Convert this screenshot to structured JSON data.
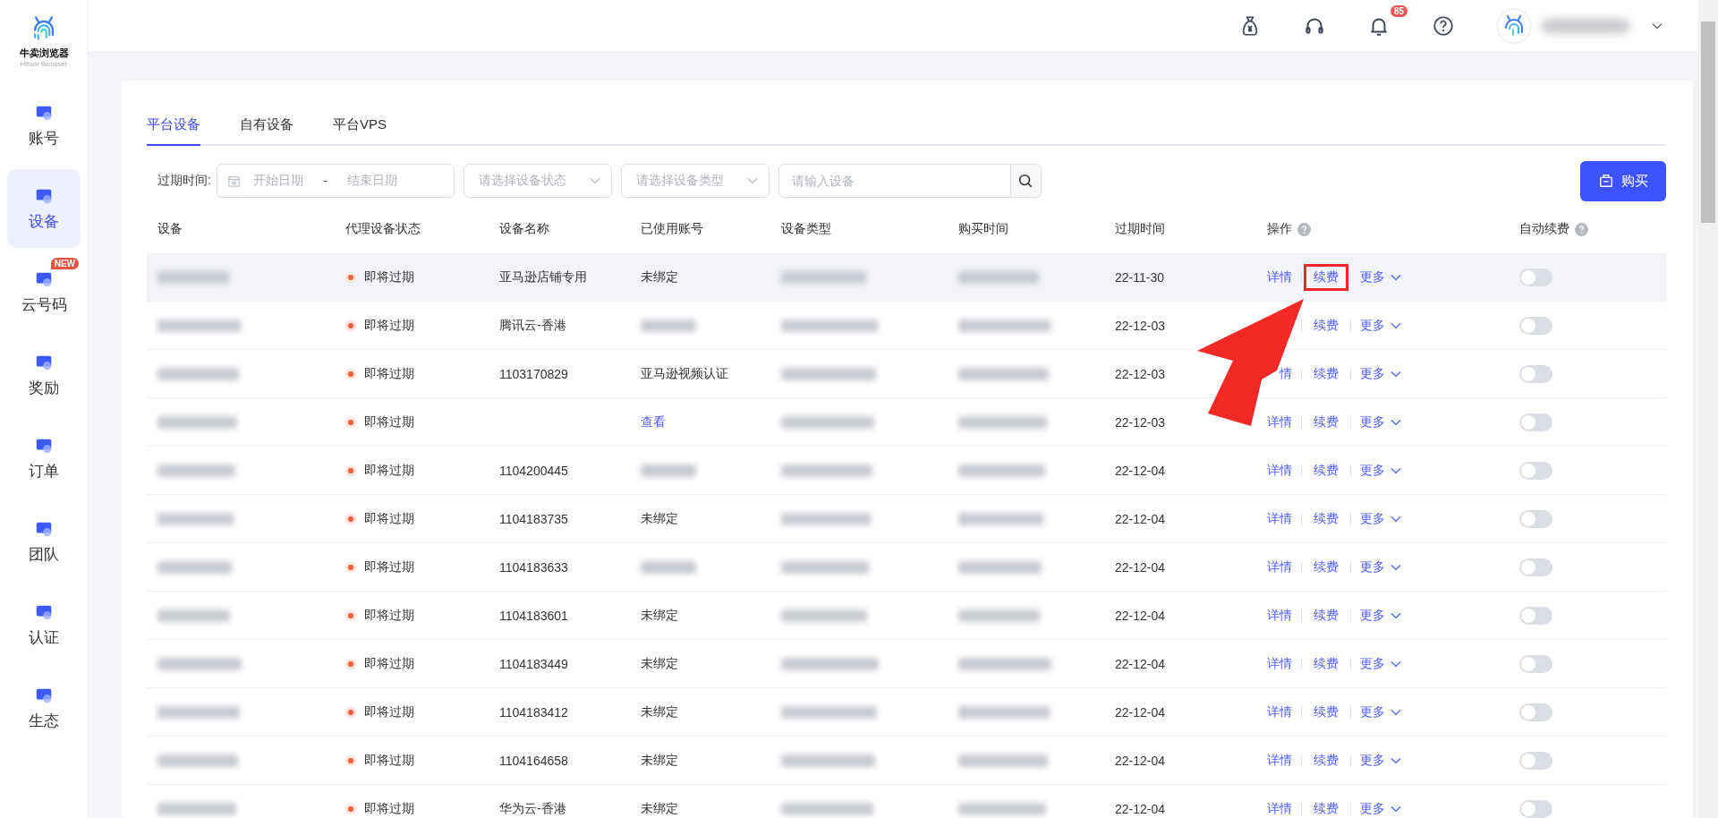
{
  "logo": {
    "title": "牛卖浏览器",
    "subtitle": "Hitoor Browser"
  },
  "sidebar": {
    "items": [
      {
        "label": "账号",
        "selected": false
      },
      {
        "label": "设备",
        "selected": true
      },
      {
        "label": "云号码",
        "selected": false,
        "badge": "NEW"
      },
      {
        "label": "奖励",
        "selected": false
      },
      {
        "label": "订单",
        "selected": false
      },
      {
        "label": "团队",
        "selected": false
      },
      {
        "label": "认证",
        "selected": false
      },
      {
        "label": "生态",
        "selected": false
      }
    ]
  },
  "header": {
    "notification_count": "85"
  },
  "tabs": [
    {
      "label": "平台设备",
      "selected": true
    },
    {
      "label": "自有设备",
      "selected": false
    },
    {
      "label": "平台VPS",
      "selected": false
    }
  ],
  "filters": {
    "label": "过期时间:",
    "start_placeholder": "开始日期",
    "separator": "-",
    "end_placeholder": "结束日期",
    "status_placeholder": "请选择设备状态",
    "type_placeholder": "请选择设备类型",
    "search_placeholder": "请输入设备"
  },
  "buy_button": "购买",
  "table": {
    "columns": [
      {
        "label": "设备",
        "kind": "redacted"
      },
      {
        "label": "代理设备状态",
        "kind": "status"
      },
      {
        "label": "设备名称",
        "kind": "name"
      },
      {
        "label": "已使用账号",
        "kind": "account"
      },
      {
        "label": "设备类型",
        "kind": "redacted"
      },
      {
        "label": "购买时间",
        "kind": "redacted"
      },
      {
        "label": "过期时间",
        "kind": "expiry"
      },
      {
        "label": "操作",
        "kind": "ops",
        "help": true
      },
      {
        "label": "自动续费",
        "kind": "toggle",
        "help": true
      }
    ],
    "rows": [
      {
        "status": "即将过期",
        "name": "亚马逊店铺专用",
        "account": {
          "kind": "text",
          "text": "未绑定"
        },
        "expiry": "22-11-30",
        "detail": "详情",
        "renew": "续费",
        "renew_annotated": true,
        "more": "更多",
        "auto_renew": false,
        "highlighted": true
      },
      {
        "status": "即将过期",
        "name": "腾讯云-香港",
        "account": {
          "kind": "redacted"
        },
        "expiry": "22-12-03",
        "renew": "续费",
        "renew_annotated": false,
        "more": "更多",
        "auto_renew": false,
        "highlighted": false
      },
      {
        "status": "即将过期",
        "name": "1103170829",
        "account": {
          "kind": "text",
          "text": "亚马逊视频认证"
        },
        "expiry": "22-12-03",
        "detail": "情",
        "renew": "续费",
        "renew_annotated": false,
        "more": "更多",
        "auto_renew": false,
        "highlighted": false
      },
      {
        "status": "即将过期",
        "account": {
          "kind": "link",
          "text": "查看"
        },
        "expiry": "22-12-03",
        "detail": "详情",
        "renew": "续费",
        "renew_annotated": false,
        "more": "更多",
        "auto_renew": false,
        "highlighted": false
      },
      {
        "status": "即将过期",
        "name": "1104200445",
        "account": {
          "kind": "redacted"
        },
        "expiry": "22-12-04",
        "detail": "详情",
        "renew": "续费",
        "renew_annotated": false,
        "more": "更多",
        "auto_renew": false,
        "highlighted": false
      },
      {
        "status": "即将过期",
        "name": "1104183735",
        "account": {
          "kind": "text",
          "text": "未绑定"
        },
        "expiry": "22-12-04",
        "detail": "详情",
        "renew": "续费",
        "renew_annotated": false,
        "more": "更多",
        "auto_renew": false,
        "highlighted": false
      },
      {
        "status": "即将过期",
        "name": "1104183633",
        "account": {
          "kind": "redacted"
        },
        "expiry": "22-12-04",
        "detail": "详情",
        "renew": "续费",
        "renew_annotated": false,
        "more": "更多",
        "auto_renew": false,
        "highlighted": false
      },
      {
        "status": "即将过期",
        "name": "1104183601",
        "account": {
          "kind": "text",
          "text": "未绑定"
        },
        "expiry": "22-12-04",
        "detail": "详情",
        "renew": "续费",
        "renew_annotated": false,
        "more": "更多",
        "auto_renew": false,
        "highlighted": false
      },
      {
        "status": "即将过期",
        "name": "1104183449",
        "account": {
          "kind": "text",
          "text": "未绑定"
        },
        "expiry": "22-12-04",
        "detail": "详情",
        "renew": "续费",
        "renew_annotated": false,
        "more": "更多",
        "auto_renew": false,
        "highlighted": false
      },
      {
        "status": "即将过期",
        "name": "1104183412",
        "account": {
          "kind": "text",
          "text": "未绑定"
        },
        "expiry": "22-12-04",
        "detail": "详情",
        "renew": "续费",
        "renew_annotated": false,
        "more": "更多",
        "auto_renew": false,
        "highlighted": false
      },
      {
        "status": "即将过期",
        "name": "1104164658",
        "account": {
          "kind": "text",
          "text": "未绑定"
        },
        "expiry": "22-12-04",
        "detail": "详情",
        "renew": "续费",
        "renew_annotated": false,
        "more": "更多",
        "auto_renew": false,
        "highlighted": false
      },
      {
        "status": "即将过期",
        "name": "华为云-香港",
        "account": {
          "kind": "text",
          "text": "未绑定"
        },
        "expiry": "22-12-04",
        "detail": "详情",
        "renew": "续费",
        "renew_annotated": false,
        "more": "更多",
        "auto_renew": false,
        "highlighted": false
      }
    ]
  }
}
